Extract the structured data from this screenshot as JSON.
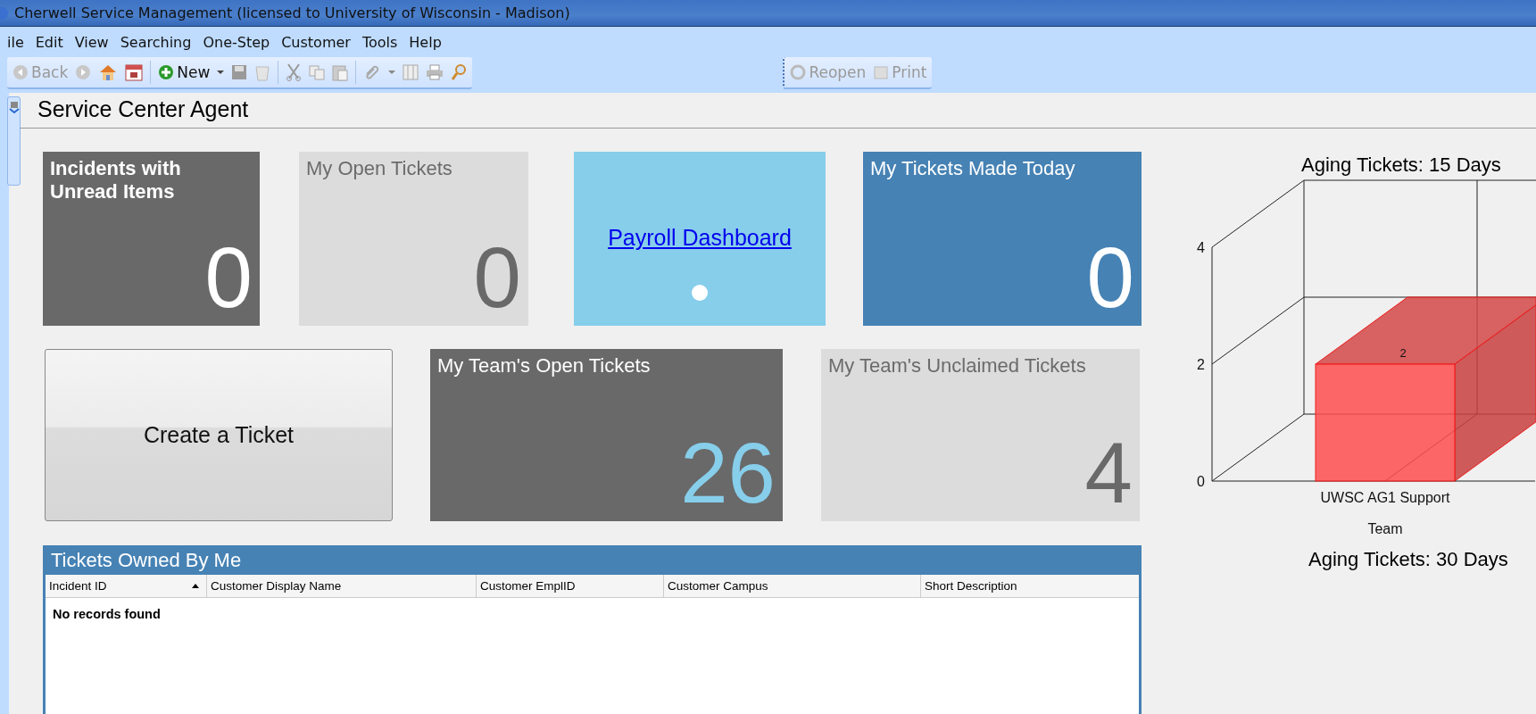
{
  "window": {
    "title": "Cherwell Service Management (licensed to University of Wisconsin - Madison)"
  },
  "menu": [
    "ile",
    "Edit",
    "View",
    "Searching",
    "One-Step",
    "Customer",
    "Tools",
    "Help"
  ],
  "toolbar": {
    "back": {
      "label": "Back",
      "disabled": true
    },
    "new": {
      "label": "New",
      "disabled": false
    }
  },
  "toolbar_2": [
    {
      "label": "Reopen",
      "disabled": true
    },
    {
      "label": "Print",
      "disabled": true
    }
  ],
  "heading": "Service Center Agent",
  "tiles_row_1": [
    {
      "kind": "count",
      "title": "Incidents with Unread Items",
      "bold": true,
      "count": "0",
      "color": "#696969",
      "highlighted": false
    },
    {
      "kind": "count",
      "title": "My Open Tickets",
      "bold": false,
      "count": "0",
      "color": "#dcdcdc",
      "highlighted": false
    },
    {
      "kind": "link",
      "link": "Payroll Dashboard",
      "color": "#87ceeb"
    },
    {
      "kind": "count",
      "title": "My Tickets Made Today",
      "bold": false,
      "count": "0",
      "color": "#4682b4",
      "highlighted": false
    }
  ],
  "create_button": "Create a Ticket",
  "tiles_row_2": [
    {
      "kind": "count",
      "title": "My Team's Open Tickets",
      "bold": false,
      "count": "26",
      "color": "#696969",
      "highlighted": true
    },
    {
      "kind": "count",
      "title": "My Team's Unclaimed Tickets",
      "bold": false,
      "count": "4",
      "color": "#dcdcdc",
      "highlighted": false
    }
  ],
  "table": {
    "title": "Tickets Owned By Me",
    "columns": [
      {
        "label": "Incident ID",
        "sorted": true
      },
      {
        "label": "Customer Display Name",
        "sorted": false
      },
      {
        "label": "Customer EmplID",
        "sorted": false
      },
      {
        "label": "Customer Campus",
        "sorted": false
      },
      {
        "label": "Short Description",
        "sorted": false
      }
    ],
    "empty_message": "No records found"
  },
  "chart_data": {
    "type": "bar",
    "title": "Aging Tickets: 15 Days",
    "xlabel": "Team",
    "categories": [
      "UWSC AG1 Support"
    ],
    "series": [
      {
        "color": "#ff4d4d",
        "values": [
          2
        ]
      }
    ],
    "ylim": [
      0,
      4
    ],
    "yticks": [
      0,
      2,
      4
    ],
    "data_labels": true
  },
  "chart_2": {
    "title": "Aging Tickets: 30 Days"
  }
}
